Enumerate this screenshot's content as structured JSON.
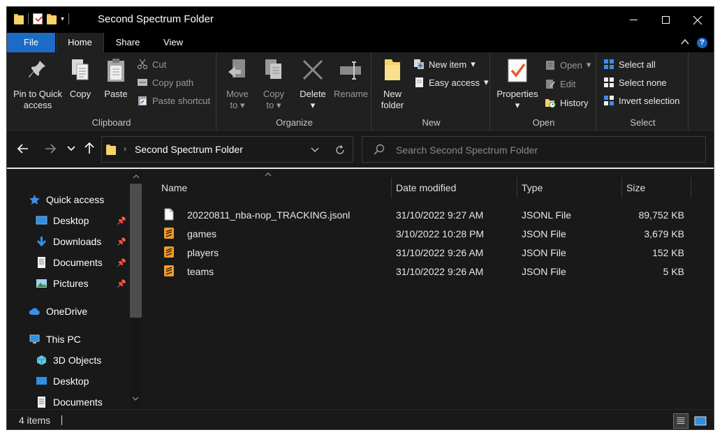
{
  "window": {
    "title": "Second Spectrum Folder"
  },
  "ribbon_tabs": [
    "File",
    "Home",
    "Share",
    "View"
  ],
  "help_glyph": "?",
  "ribbon": {
    "clipboard": {
      "label": "Clipboard",
      "pin_line1": "Pin to Quick",
      "pin_line2": "access",
      "copy": "Copy",
      "paste": "Paste",
      "cut": "Cut",
      "copy_path": "Copy path",
      "paste_shortcut": "Paste shortcut"
    },
    "organize": {
      "label": "Organize",
      "move_line1": "Move",
      "move_line2": "to",
      "copy_line1": "Copy",
      "copy_line2": "to",
      "delete": "Delete",
      "rename": "Rename"
    },
    "new": {
      "label": "New",
      "folder_line1": "New",
      "folder_line2": "folder",
      "new_item": "New item",
      "easy_access": "Easy access"
    },
    "open": {
      "label": "Open",
      "properties": "Properties",
      "open": "Open",
      "edit": "Edit",
      "history": "History"
    },
    "select": {
      "label": "Select",
      "select_all": "Select all",
      "select_none": "Select none",
      "invert": "Invert selection"
    }
  },
  "address": {
    "crumb": "Second Spectrum Folder",
    "search_placeholder": "Search Second Spectrum Folder"
  },
  "nav_pane": {
    "quick_access": "Quick access",
    "quick_items": [
      "Desktop",
      "Downloads",
      "Documents",
      "Pictures"
    ],
    "onedrive": "OneDrive",
    "this_pc": "This PC",
    "pc_items": [
      "3D Objects",
      "Desktop",
      "Documents"
    ]
  },
  "columns": {
    "name": "Name",
    "date": "Date modified",
    "type": "Type",
    "size": "Size"
  },
  "files": [
    {
      "name": "20220811_nba-nop_TRACKING.jsonl",
      "date": "31/10/2022 9:27 AM",
      "type": "JSONL File",
      "size": "89,752 KB",
      "icon": "blank-file-icon"
    },
    {
      "name": "games",
      "date": "3/10/2022 10:28 PM",
      "type": "JSON File",
      "size": "3,679 KB",
      "icon": "sublime-file-icon"
    },
    {
      "name": "players",
      "date": "31/10/2022 9:26 AM",
      "type": "JSON File",
      "size": "152 KB",
      "icon": "sublime-file-icon"
    },
    {
      "name": "teams",
      "date": "31/10/2022 9:26 AM",
      "type": "JSON File",
      "size": "5 KB",
      "icon": "sublime-file-icon"
    }
  ],
  "status": {
    "items": "4 items"
  },
  "colors": {
    "accent": "#1c6bc4",
    "background": "#191919",
    "ribbon": "#202020",
    "folder": "#f8d26a"
  }
}
